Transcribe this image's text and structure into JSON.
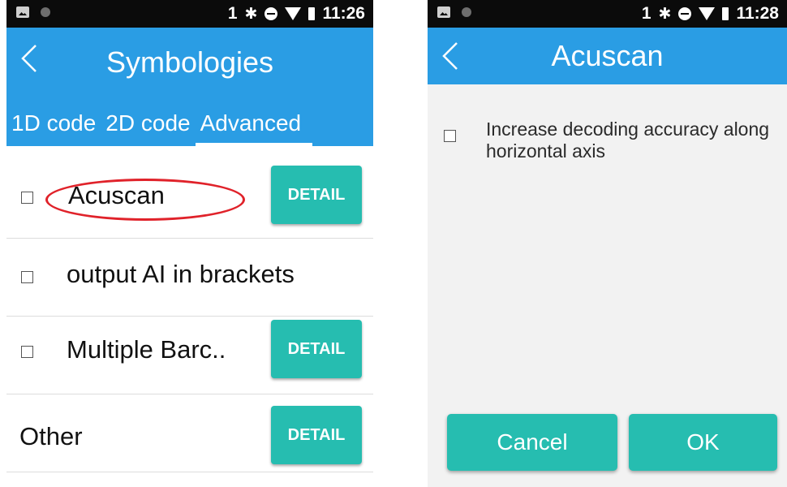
{
  "left": {
    "status": {
      "sim": "1",
      "bt": "✱",
      "time": "11:26"
    },
    "title": "Symbologies",
    "tabs": [
      "1D code",
      "2D code",
      "Advanced"
    ],
    "items": [
      {
        "label": "Acuscan",
        "has_checkbox": true,
        "button": "DETAIL"
      },
      {
        "label": "output AI in brackets",
        "has_checkbox": true
      },
      {
        "label": "Multiple Barc..",
        "has_checkbox": true,
        "button": "DETAIL"
      },
      {
        "label": "Other",
        "has_checkbox": false,
        "button": "DETAIL"
      }
    ]
  },
  "right": {
    "status": {
      "sim": "1",
      "bt": "✱",
      "time": "11:28"
    },
    "title": "Acuscan",
    "option": {
      "label": "Increase decoding accuracy along horizontal axis",
      "checked": false
    },
    "buttons": {
      "cancel": "Cancel",
      "ok": "OK"
    }
  },
  "colors": {
    "appbar": "#2a9de4",
    "button": "#26bdb0",
    "highlight": "#e0222a"
  }
}
